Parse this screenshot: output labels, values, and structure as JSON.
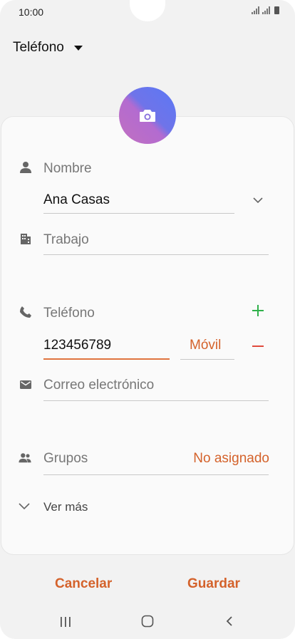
{
  "status_bar": {
    "time": "10:00"
  },
  "header": {
    "account_label": "Teléfono"
  },
  "form": {
    "name": {
      "label": "Nombre",
      "value": "Ana Casas"
    },
    "work": {
      "placeholder": "Trabajo"
    },
    "phone": {
      "label": "Teléfono",
      "value": "123456789",
      "type": "Móvil"
    },
    "email": {
      "placeholder": "Correo electrónico"
    },
    "groups": {
      "label": "Grupos",
      "value": "No asignado"
    },
    "more": {
      "label": "Ver más"
    }
  },
  "actions": {
    "cancel": "Cancelar",
    "save": "Guardar"
  },
  "colors": {
    "accent": "#d4622b",
    "add": "#2fb04a",
    "remove": "#e04a3c"
  }
}
